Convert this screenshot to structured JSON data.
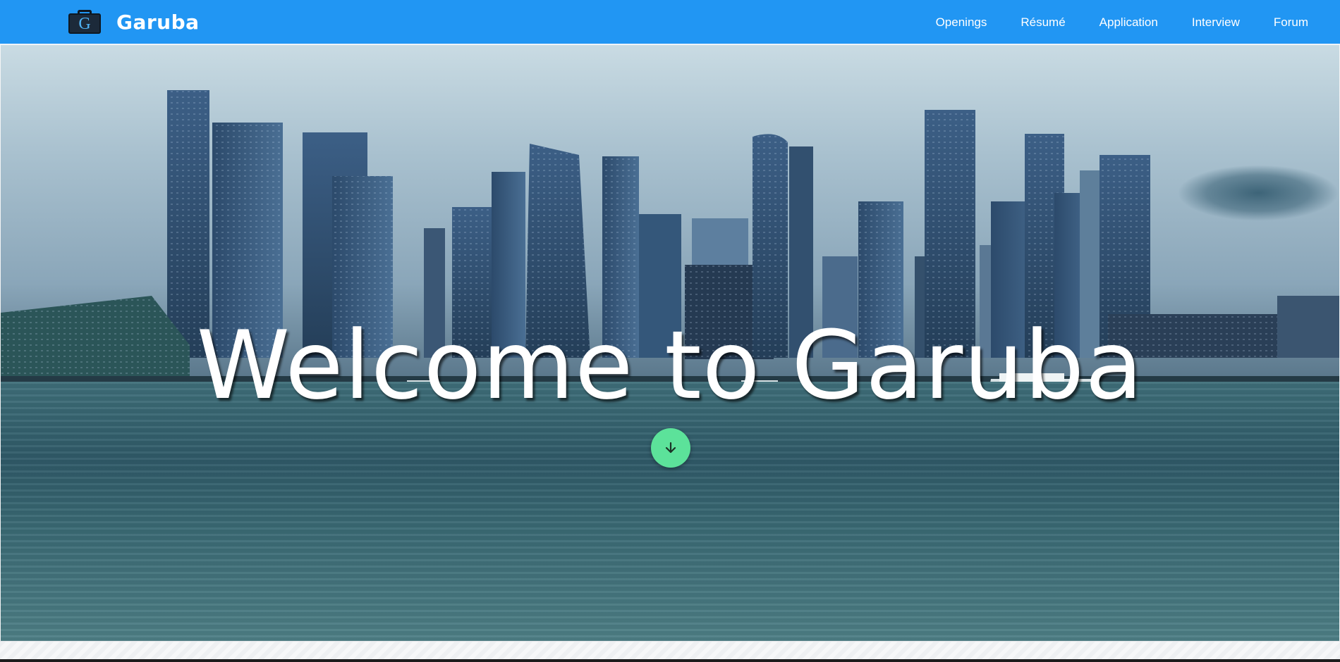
{
  "navbar": {
    "brand": {
      "logo_letter": "G",
      "name": "Garuba",
      "logo_icon": "briefcase-icon"
    },
    "links": [
      {
        "label": "Openings"
      },
      {
        "label": "Résumé"
      },
      {
        "label": "Application"
      },
      {
        "label": "Interview"
      },
      {
        "label": "Forum"
      }
    ],
    "background_color": "#2196f3"
  },
  "hero": {
    "title": "Welcome to Garuba",
    "scroll_button": {
      "icon": "arrow-down-icon",
      "color": "#5ce29a"
    }
  }
}
